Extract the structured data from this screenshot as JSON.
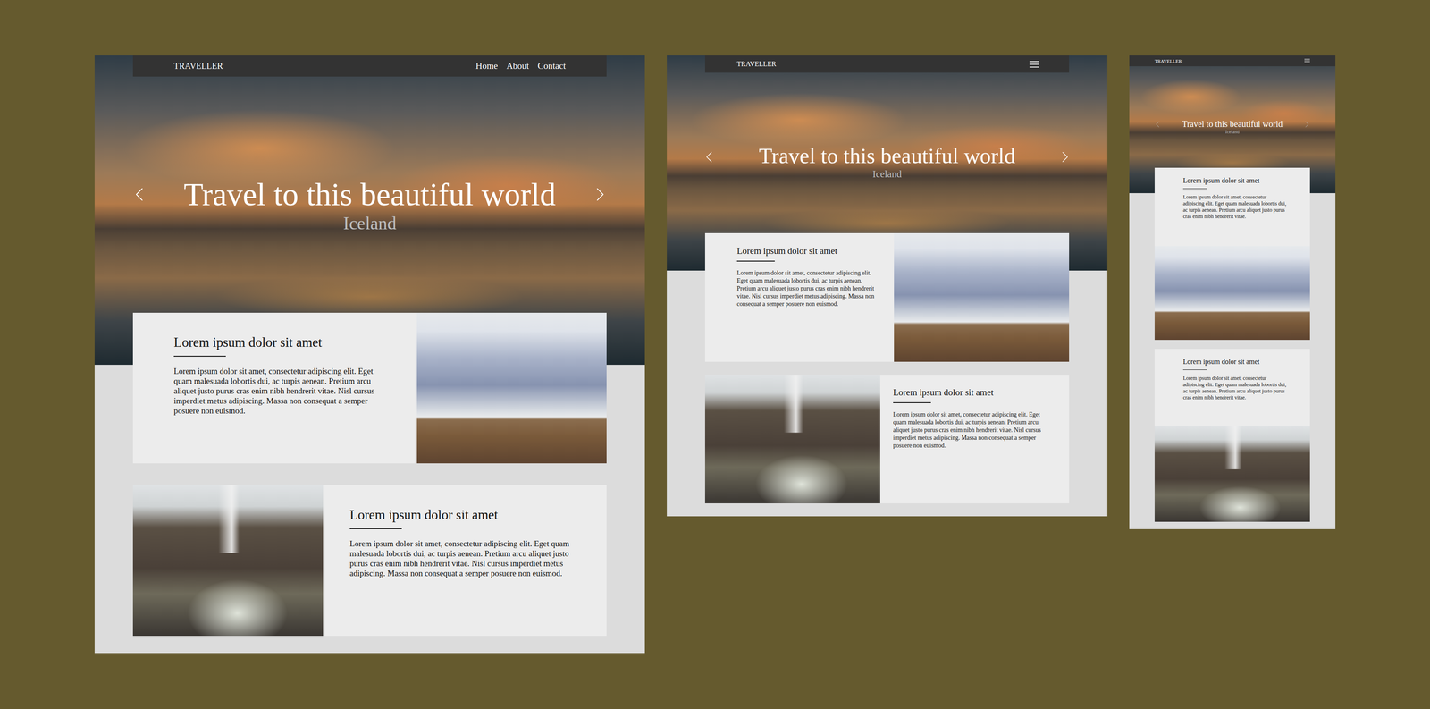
{
  "frames": [
    {
      "kind": "desktop",
      "nav": {
        "logo": "TRAVELLER",
        "links": [
          "Home",
          "About",
          "Contact"
        ]
      },
      "hero": {
        "title": "Travel to this beautiful world",
        "subtitle": "Iceland"
      },
      "cards": [
        {
          "title": "Lorem ipsum dolor sit amet",
          "body": "Lorem ipsum dolor sit amet, consectetur adipiscing elit. Eget quam malesuada lobortis dui, ac turpis aenean. Pretium arcu aliquet justo purus cras enim nibh hendrerit vitae. Nisl cursus imperdiet metus adipiscing. Massa non consequat a semper posuere non euismod."
        },
        {
          "title": "Lorem ipsum dolor sit amet",
          "body": "Lorem ipsum dolor sit amet, consectetur adipiscing elit. Eget quam malesuada lobortis dui, ac turpis aenean. Pretium arcu aliquet justo purus cras enim nibh hendrerit vitae. Nisl cursus imperdiet metus adipiscing. Massa non consequat a semper posuere non euismod."
        }
      ]
    },
    {
      "kind": "tablet",
      "nav": {
        "logo": "TRAVELLER",
        "links": []
      },
      "hero": {
        "title": "Travel to this beautiful world",
        "subtitle": "Iceland"
      },
      "cards": [
        {
          "title": "Lorem ipsum dolor sit amet",
          "body": "Lorem ipsum dolor sit amet, consectetur adipiscing elit. Eget quam malesuada lobortis dui, ac turpis aenean. Pretium arcu aliquet justo purus cras enim nibh hendrerit vitae. Nisl cursus imperdiet metus adipiscing. Massa non consequat a semper posuere non euismod."
        },
        {
          "title": "Lorem ipsum dolor sit amet",
          "body": "Lorem ipsum dolor sit amet, consectetur adipiscing elit. Eget quam malesuada lobortis dui, ac turpis aenean. Pretium arcu aliquet justo purus cras enim nibh hendrerit vitae. Nisl cursus imperdiet metus adipiscing. Massa non consequat a semper posuere non euismod."
        }
      ]
    },
    {
      "kind": "mobile",
      "nav": {
        "logo": "TRAVELLER",
        "links": []
      },
      "hero": {
        "title": "Travel to this beautiful world",
        "subtitle": "Iceland"
      },
      "cards": [
        {
          "title": "Lorem ipsum dolor sit amet",
          "body": "Lorem ipsum dolor sit amet, consectetur adipiscing elit. Eget quam malesuada lobortis dui, ac turpis aenean. Pretium arcu aliquet justo purus cras enim nibh hendrerit vitae."
        },
        {
          "title": "Lorem ipsum dolor sit amet",
          "body": "Lorem ipsum dolor sit amet, consectetur adipiscing elit. Eget quam malesuada lobortis dui, ac turpis aenean. Pretium arcu aliquet justo purus cras enim nibh hendrerit vitae."
        }
      ]
    }
  ]
}
